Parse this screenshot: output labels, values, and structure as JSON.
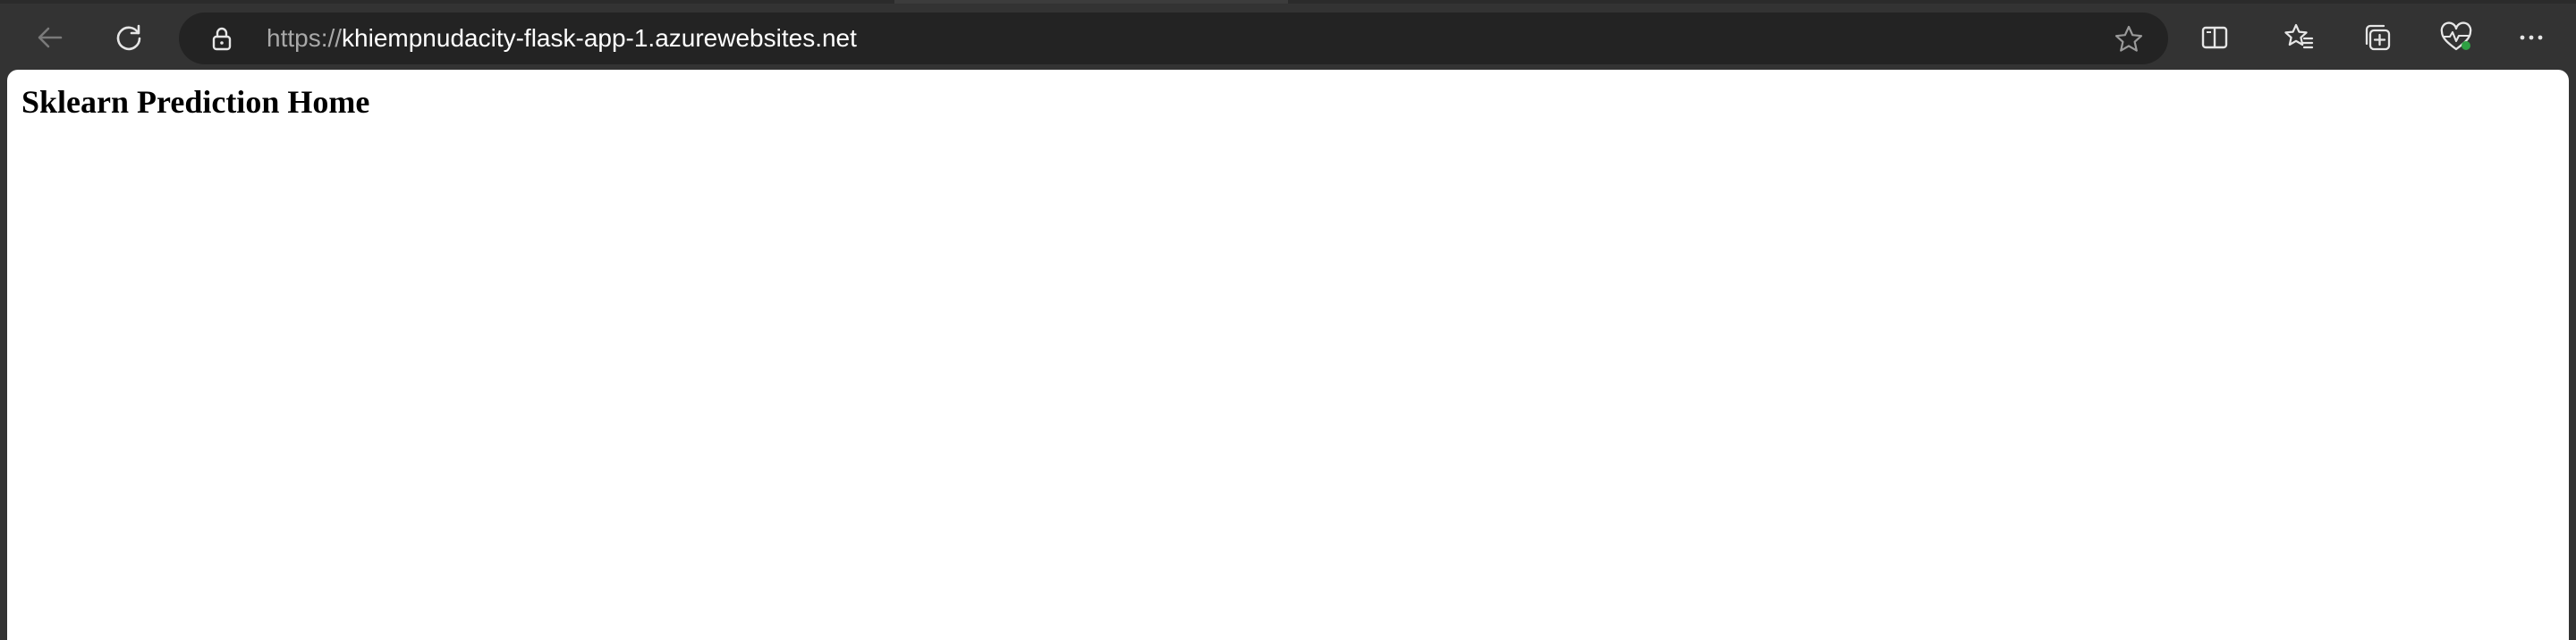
{
  "browser": {
    "address_bar": {
      "url_scheme": "https://",
      "url_host": "khiempnudacity-flask-app-1.azurewebsites.net"
    },
    "toolbar": {
      "left_icons": [
        "back-arrow-icon",
        "refresh-icon"
      ],
      "right_icons": [
        "split-screen-icon",
        "favorites-icon",
        "collections-icon",
        "browser-essentials-icon",
        "more-menu-icon"
      ]
    },
    "colors": {
      "chrome_background": "#333333",
      "address_bar_background": "#232323",
      "url_text": "#ffffff",
      "url_scheme_text": "#a8a8a8",
      "status_dot": "#2ea043"
    }
  },
  "page": {
    "heading": "Sklearn Prediction Home"
  }
}
